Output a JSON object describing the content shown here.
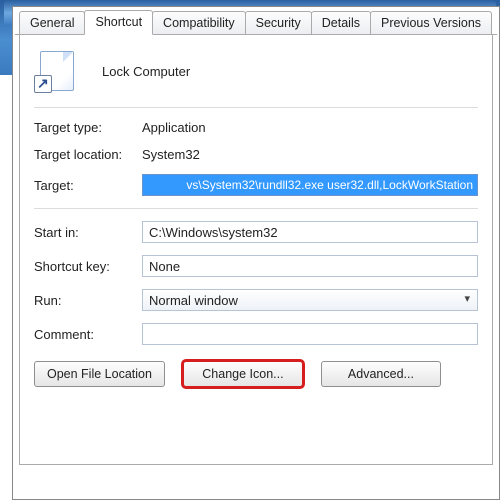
{
  "tabs": {
    "general": "General",
    "shortcut": "Shortcut",
    "compatibility": "Compatibility",
    "security": "Security",
    "details": "Details",
    "previous": "Previous Versions"
  },
  "header": {
    "title": "Lock Computer"
  },
  "fields": {
    "target_type_label": "Target type:",
    "target_type_value": "Application",
    "target_location_label": "Target location:",
    "target_location_value": "System32",
    "target_label": "Target:",
    "target_value": "vs\\System32\\rundll32.exe user32.dll,LockWorkStation",
    "start_in_label": "Start in:",
    "start_in_value": "C:\\Windows\\system32",
    "shortcut_key_label": "Shortcut key:",
    "shortcut_key_value": "None",
    "run_label": "Run:",
    "run_value": "Normal window",
    "comment_label": "Comment:",
    "comment_value": ""
  },
  "buttons": {
    "open_file_location": "Open File Location",
    "change_icon": "Change Icon...",
    "advanced": "Advanced..."
  }
}
